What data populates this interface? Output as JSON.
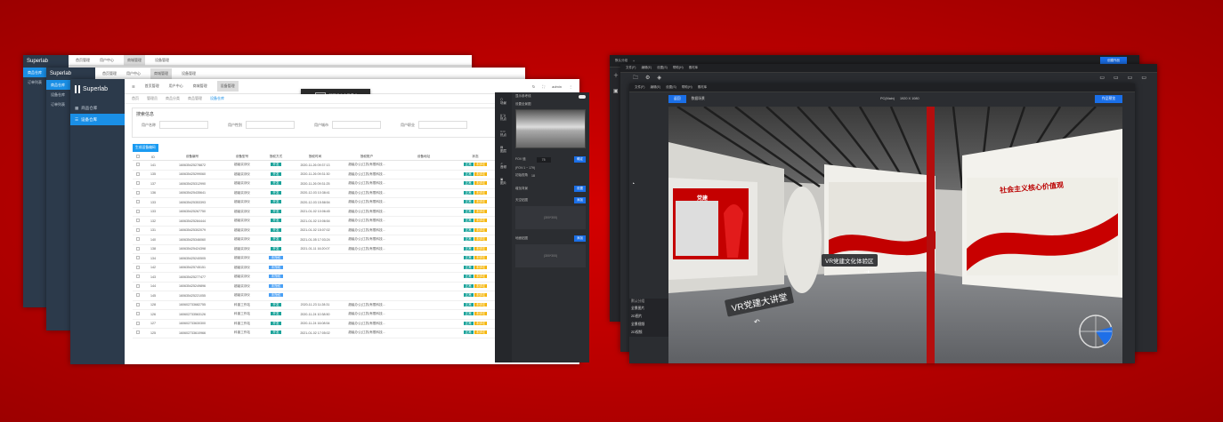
{
  "admin": {
    "brand": "Superlab",
    "brand_sub": "",
    "top_nav": [
      "首页管理",
      "用户中心",
      "商城管理",
      "设备管理"
    ],
    "back_top_nav": [
      "首页管理",
      "用户中心",
      "商城管理",
      "设备管理"
    ],
    "user": "admin",
    "side_menu": [
      "商品仓库",
      "设备仓库",
      "订单列表"
    ],
    "tabs": [
      "首页",
      "管理员",
      "商品分类",
      "商品管理",
      "设备仓库"
    ],
    "search_title": "搜索信息",
    "fields": [
      "用户名称",
      "用户性别",
      "用户城市",
      "用户职业"
    ],
    "search_button": "搜 索",
    "generate_button": "生成设备编码",
    "tooltip_key": "F11",
    "tooltip_text": "即可退出全屏模式",
    "columns": [
      "ID",
      "设备编号",
      "设备型号",
      "授权方式",
      "授权时间",
      "授权账户",
      "设备地址",
      "状态",
      "操作"
    ],
    "rows": [
      {
        "id": "141",
        "code": "160635425278872",
        "model": "超级实训仪",
        "auth": "开发",
        "time": "2020-11-26 09:37:13",
        "acct": "超级办公(江苏)有限科技...",
        "s1": "正常",
        "s2": "未绑定"
      },
      {
        "id": "135",
        "code": "160635425299060",
        "model": "超级实训仪",
        "auth": "开发",
        "time": "2020-11-26 09:31:30",
        "acct": "超级办公(江苏)有限科技...",
        "s1": "正常",
        "s2": "未绑定"
      },
      {
        "id": "137",
        "code": "160635425312990",
        "model": "超级实训仪",
        "auth": "开发",
        "time": "2020-11-26 09:31:25",
        "acct": "超级办公(江苏)有限科技...",
        "s1": "正常",
        "s2": "未绑定"
      },
      {
        "id": "136",
        "code": "160635425435641",
        "model": "超级实训仪",
        "auth": "开发",
        "time": "2020-12-03 10:38:41",
        "acct": "超级办公(江苏)有限科技...",
        "s1": "正常",
        "s2": "未绑定"
      },
      {
        "id": "133",
        "code": "160635425353393",
        "model": "超级实训仪",
        "auth": "开发",
        "time": "2020-12-03 15:58:54",
        "acct": "超级办公(江苏)有限科技...",
        "s1": "正常",
        "s2": "未绑定"
      },
      {
        "id": "133",
        "code": "160635425267750",
        "model": "超级实训仪",
        "auth": "开发",
        "time": "2021-01-02 10:06:45",
        "acct": "超级办公(江苏)有限科技...",
        "s1": "正常",
        "s2": "未绑定"
      },
      {
        "id": "132",
        "code": "160635425284444",
        "model": "超级实训仪",
        "auth": "开发",
        "time": "2021-01-02 10:06:54",
        "acct": "超级办公(江苏)有限科技...",
        "s1": "正常",
        "s2": "未绑定"
      },
      {
        "id": "131",
        "code": "160635425302079",
        "model": "超级实训仪",
        "auth": "开发",
        "time": "2021-01-02 15:07:02",
        "acct": "超级办公(江苏)有限科技...",
        "s1": "正常",
        "s2": "未绑定"
      },
      {
        "id": "140",
        "code": "160635425346060",
        "model": "超级实训仪",
        "auth": "开发",
        "time": "2021-01-05 17:03:24",
        "acct": "超级办公(江苏)有限科技...",
        "s1": "正常",
        "s2": "未绑定"
      },
      {
        "id": "138",
        "code": "160635425424398",
        "model": "超级实训仪",
        "auth": "开发",
        "time": "2021-01-11 16:20:07",
        "acct": "超级办公(江苏)有限科技...",
        "s1": "正常",
        "s2": "未绑定"
      },
      {
        "id": "134",
        "code": "160635425240505",
        "model": "超级实训仪",
        "auth": "未授权",
        "time": "",
        "acct": "",
        "s1": "正常",
        "s2": "未绑定"
      },
      {
        "id": "142",
        "code": "160635425745151",
        "model": "超级实训仪",
        "auth": "未授权",
        "time": "",
        "acct": "",
        "s1": "正常",
        "s2": "未绑定"
      },
      {
        "id": "143",
        "code": "160635425277477",
        "model": "超级实训仪",
        "auth": "未授权",
        "time": "",
        "acct": "",
        "s1": "正常",
        "s2": "未绑定"
      },
      {
        "id": "144",
        "code": "160635425249896",
        "model": "超级实训仪",
        "auth": "未授权",
        "time": "",
        "acct": "",
        "s1": "正常",
        "s2": "未绑定"
      },
      {
        "id": "145",
        "code": "160635425221055",
        "model": "超级实训仪",
        "auth": "未授权",
        "time": "",
        "acct": "",
        "s1": "正常",
        "s2": "未绑定"
      },
      {
        "id": "128",
        "code": "160602733682755",
        "model": "科普工作站",
        "auth": "开发",
        "time": "2020-11-23 11:28:31",
        "acct": "超级办公(江苏)有限科技...",
        "s1": "正常",
        "s2": "未绑定"
      },
      {
        "id": "126",
        "code": "160602733563126",
        "model": "科普工作站",
        "auth": "开发",
        "time": "2020-11-24 10:38:50",
        "acct": "超级办公(江苏)有限科技...",
        "s1": "正常",
        "s2": "未绑定"
      },
      {
        "id": "127",
        "code": "160602733630300",
        "model": "科普工作站",
        "auth": "开发",
        "time": "2020-11-24 16:08:54",
        "acct": "超级办公(江苏)有限科技...",
        "s1": "正常",
        "s2": "未绑定"
      },
      {
        "id": "125",
        "code": "160602733610966",
        "model": "科普工作站",
        "auth": "开发",
        "time": "2021-01-02 17:05:02",
        "acct": "超级办公(江苏)有限科技...",
        "s1": "正常",
        "s2": "未绑定"
      }
    ],
    "op1": "设备详情",
    "op2": "绑定用户"
  },
  "vr": {
    "project_tab": "默认分组",
    "menu": [
      "文件(F)",
      "编辑(E)",
      "设置(S)",
      "帮助(H)",
      "素材库"
    ],
    "back_button": "返回",
    "view_label": "数据场景",
    "resolution_mode": "PC(Main)",
    "resolution": "1920 X 1080",
    "publish_button": "作品预览",
    "create_button": "创建作品",
    "hotspot_1": "VR党建文化体验区",
    "hotspot_2": "VR党建大讲堂",
    "wall_text": "社会主义核心价值观",
    "left_wall_text": "党建",
    "tools": [
      "场景",
      "热点",
      "热点",
      "图层",
      "音频",
      "图片"
    ],
    "panel": {
      "opt1": "显示参考线",
      "opt2": "设置全景图",
      "fov_label": "FOV 值",
      "fov_value": "75",
      "fov_btn": "确定",
      "fov_range": "(FOV:1 ~ 179)",
      "view_label": "初始视角",
      "view_value": "18",
      "bg_label": "增加背景",
      "bg_btn": "设置",
      "top_label": "天空贴图",
      "top_btn": "添加",
      "top_hint": "(300*300)",
      "bottom_label": "地面贴图",
      "bottom_btn": "添加",
      "bottom_hint": "(300*300)"
    },
    "scene_list": [
      "全景图片",
      "2D图片",
      "全景视频",
      "2D视频"
    ],
    "scene_list_title": "默认分组"
  }
}
